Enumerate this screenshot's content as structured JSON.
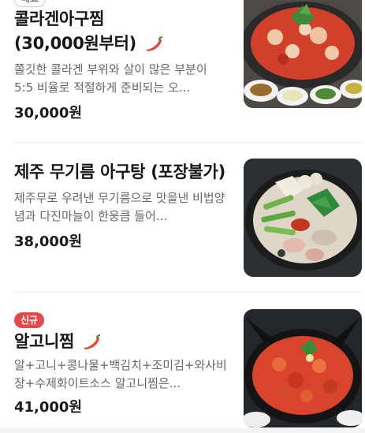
{
  "items": [
    {
      "badge": "대표",
      "name": "콜라겐아구찜 (30,000원부터)",
      "spicy": true,
      "description": "쫄깃한 콜라겐 부위와 살이 많은 부분이 5:5 비율로 적절하게 준비되는 오...",
      "price": "30,000원",
      "image": "stew-photo"
    },
    {
      "name": "제주 무기름 아구탕 (포장불가)",
      "spicy": false,
      "description": "제주무로 우려낸 무기름으로 맛을낸 비법양념과 다진마늘이 한웅큼 들어...",
      "price": "38,000원",
      "image": "soup-photo"
    },
    {
      "badge": "신규",
      "name": "알고니찜",
      "spicy": true,
      "description": "알+고니+콩나물+백김치+조미김+와사비장+수제화이트소스 알고니찜은...",
      "price": "41,000원",
      "image": "stew-photo"
    }
  ],
  "colors": {
    "badge_new": "#e5484d",
    "chili": "#e24a3b"
  }
}
